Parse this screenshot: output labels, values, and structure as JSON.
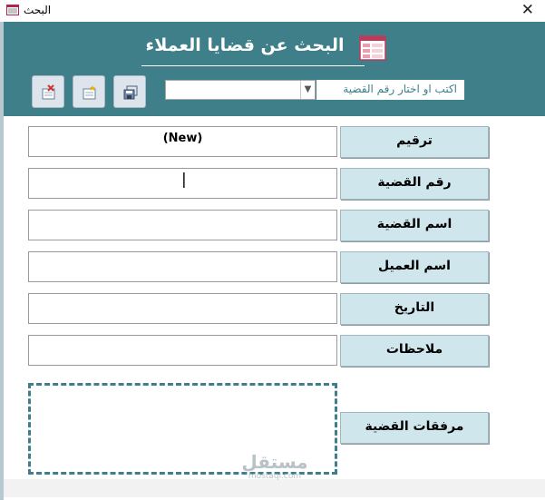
{
  "window": {
    "title": "البحث",
    "close_glyph": "✕"
  },
  "header": {
    "title": "البحث عن قضايا العملاء",
    "icon": "form-icon"
  },
  "toolbar": {
    "buttons": [
      {
        "name": "delete-record-button",
        "icon": "delete-record-icon"
      },
      {
        "name": "new-record-button",
        "icon": "new-record-icon"
      },
      {
        "name": "save-record-button",
        "icon": "save-icon"
      }
    ]
  },
  "search": {
    "label": "اكتب او اختار رقم القضية",
    "value": ""
  },
  "fields": [
    {
      "label": "ترقيم",
      "value": "(New)"
    },
    {
      "label": "رقم القضية",
      "value": ""
    },
    {
      "label": "اسم القضية",
      "value": ""
    },
    {
      "label": "اسم العميل",
      "value": ""
    },
    {
      "label": "التاريخ",
      "value": ""
    },
    {
      "label": "ملاحظات",
      "value": ""
    }
  ],
  "attachments": {
    "label": "مرفقات القضية"
  },
  "watermark": {
    "arabic": "مستقل",
    "latin": "mostaql.com"
  },
  "colors": {
    "header_bg": "#3e7f8a",
    "label_bg": "#cfe6ec",
    "dashed_border": "#3e7f8a"
  }
}
